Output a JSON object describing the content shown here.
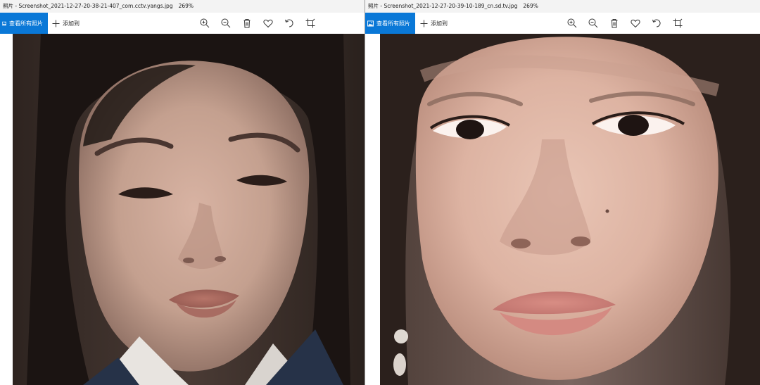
{
  "windows": [
    {
      "title": "照片 - Screenshot_2021-12-27-20-38-21-407_com.cctv.yangs.jpg",
      "zoom": "269%",
      "view_all_label": "查看所有照片",
      "add_to_label": "添加到"
    },
    {
      "title": "照片 - Screenshot_2021-12-27-20-39-10-189_cn.sd.tv.jpg",
      "zoom": "269%",
      "view_all_label": "查看所有照片",
      "add_to_label": "添加到"
    }
  ],
  "toolbar_icons": [
    "zoom-in-icon",
    "zoom-out-icon",
    "delete-icon",
    "favorite-icon",
    "rotate-icon",
    "crop-icon"
  ],
  "colors": {
    "accent": "#0a78d7",
    "titlebar": "#f3f3f3"
  }
}
